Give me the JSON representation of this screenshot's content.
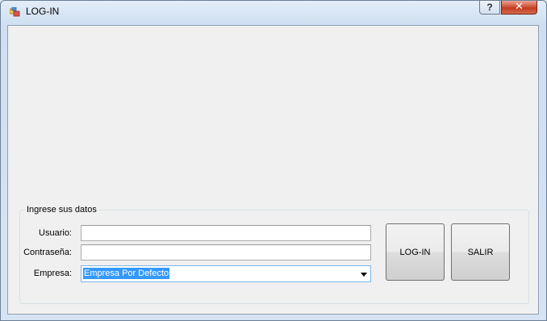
{
  "window": {
    "title": "LOG-IN",
    "help_label": "?",
    "close_label": "✕"
  },
  "form": {
    "group_title": "Ingrese sus datos",
    "usuario_label": "Usuario:",
    "usuario_value": "",
    "password_label": "Contraseña:",
    "password_value": "",
    "empresa_label": "Empresa:",
    "empresa_selected": "Empresa Por Defecto"
  },
  "buttons": {
    "login_label": "LOG-IN",
    "salir_label": "SALIR"
  },
  "icons": {
    "app": "app-window-icon",
    "help": "help-icon",
    "close": "close-icon",
    "dropdown": "chevron-down-icon"
  },
  "colors": {
    "selection": "#3399ff",
    "close_button": "#c23b22",
    "client_background": "#f0f0f0"
  }
}
